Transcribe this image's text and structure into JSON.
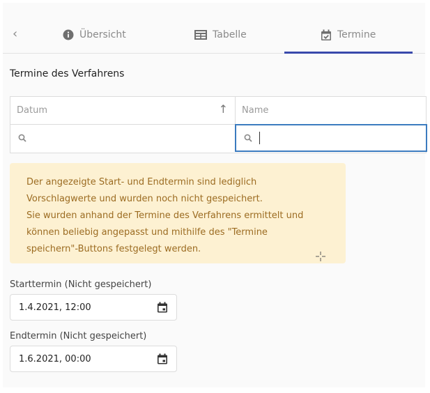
{
  "tabs": {
    "back_label": "‹",
    "items": [
      {
        "label": "Übersicht",
        "icon": "info-icon"
      },
      {
        "label": "Tabelle",
        "icon": "table-icon"
      },
      {
        "label": "Termine",
        "icon": "calendar-check-icon",
        "active": true
      }
    ]
  },
  "section": {
    "title": "Termine des Verfahrens"
  },
  "table": {
    "columns": [
      {
        "label": "Datum",
        "sort": "ascending"
      },
      {
        "label": "Name"
      }
    ],
    "filters": {
      "date_value": "",
      "name_value": ""
    }
  },
  "notice": {
    "lines": [
      "Der angezeigte Start- und Endtermin sind lediglich",
      "Vorschlagwerte und wurden noch nicht gespeichert.",
      "Sie wurden anhand der Termine des Verfahrens ermittelt und",
      "können beliebig angepasst und mithilfe des \"Termine",
      "speichern\"-Buttons festgelegt werden."
    ]
  },
  "start": {
    "label": "Starttermin (Nicht gespeichert)",
    "value": "1.4.2021, 12:00"
  },
  "end": {
    "label": "Endtermin (Nicht gespeichert)",
    "value": "1.6.2021, 00:00"
  },
  "colors": {
    "accent": "#3949ab",
    "notice_bg": "#fdf1d2",
    "notice_text": "#9c6c22",
    "focus": "#3b7bbf"
  }
}
